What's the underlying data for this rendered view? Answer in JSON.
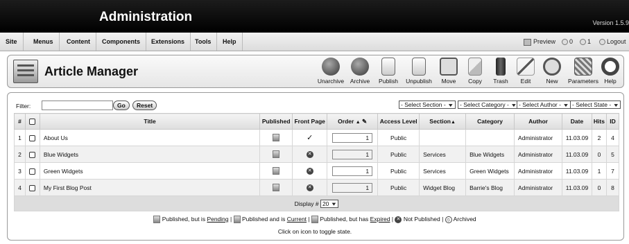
{
  "header": {
    "title": "Administration",
    "version": "Version 1.5.9"
  },
  "menu": [
    "Site",
    "Menus",
    "Content",
    "Components",
    "Extensions",
    "Tools",
    "Help"
  ],
  "status": {
    "preview": "Preview",
    "messages": "0",
    "users": "1",
    "logout": "Logout"
  },
  "page_title": "Article Manager",
  "toolbar": [
    "Unarchive",
    "Archive",
    "Publish",
    "Unpublish",
    "Move",
    "Copy",
    "Trash",
    "Edit",
    "New",
    "Parameters",
    "Help"
  ],
  "filter": {
    "label": "Filter:",
    "value": "",
    "go": "Go",
    "reset": "Reset"
  },
  "selects": [
    "- Select Section -",
    "- Select Category -",
    "- Select Author -",
    "- Select State -"
  ],
  "columns": {
    "num": "#",
    "title": "Title",
    "published": "Published",
    "front": "Front Page",
    "order": "Order",
    "access": "Access Level",
    "section": "Section",
    "category": "Category",
    "author": "Author",
    "date": "Date",
    "hits": "Hits",
    "id": "ID"
  },
  "rows": [
    {
      "num": "1",
      "title": "About Us",
      "front": "check",
      "order": "1",
      "access": "Public",
      "section": "",
      "category": "",
      "author": "Administrator",
      "date": "11.03.09",
      "hits": "2",
      "id": "4"
    },
    {
      "num": "2",
      "title": "Blue Widgets",
      "front": "x",
      "order": "1",
      "access": "Public",
      "section": "Services",
      "category": "Blue Widgets",
      "author": "Administrator",
      "date": "11.03.09",
      "hits": "0",
      "id": "5"
    },
    {
      "num": "3",
      "title": "Green Widgets",
      "front": "x",
      "order": "1",
      "access": "Public",
      "section": "Services",
      "category": "Green Widgets",
      "author": "Administrator",
      "date": "11.03.09",
      "hits": "1",
      "id": "7"
    },
    {
      "num": "4",
      "title": "My First Blog Post",
      "front": "x",
      "order": "1",
      "access": "Public",
      "section": "Widget Blog",
      "category": "Barrie's Blog",
      "author": "Administrator",
      "date": "11.03.09",
      "hits": "0",
      "id": "8"
    }
  ],
  "display": {
    "label": "Display #",
    "value": "20"
  },
  "legend": {
    "pending_pre": "Published, but is ",
    "pending": "Pending",
    "current_pre": "Published and is ",
    "current": "Current",
    "expired_pre": "Published, but has ",
    "expired": "Expired",
    "not_published": "Not Published",
    "archived": "Archived",
    "hint": "Click on icon to toggle state."
  }
}
